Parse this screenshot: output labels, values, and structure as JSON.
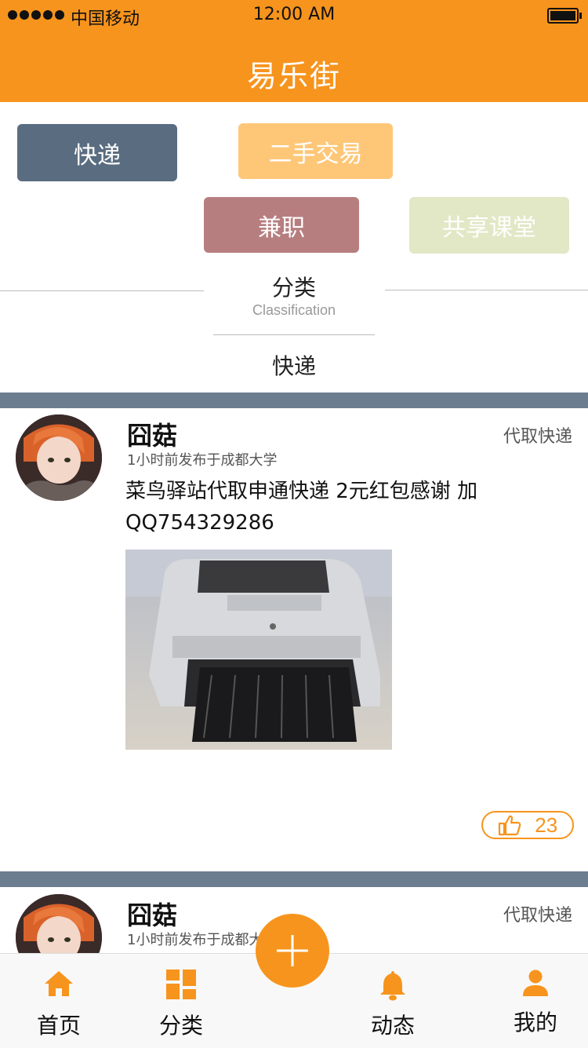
{
  "status_bar": {
    "carrier": "中国移动",
    "time": "12:00 AM"
  },
  "header": {
    "title": "易乐街"
  },
  "categories": {
    "tags": [
      {
        "label": "快递",
        "color": "#5a6d80"
      },
      {
        "label": "二手交易",
        "color": "#fec778"
      },
      {
        "label": "兼职",
        "color": "#b77e80"
      },
      {
        "label": "共享课堂",
        "color": "#e2e7c5"
      }
    ],
    "section_title": "分类",
    "section_subtitle": "Classification",
    "current": "快递"
  },
  "posts": [
    {
      "author": "囧菇",
      "time": "1小时前发布于成都大学",
      "tag": "代取快递",
      "content": "菜鸟驿站代取申通快递 2元红包感谢 加QQ754329286",
      "likes": "23",
      "image_icon": "printer-photo"
    },
    {
      "author": "囧菇",
      "time": "1小时前发布于成都大学",
      "tag": "代取快递"
    }
  ],
  "tabbar": {
    "items": [
      {
        "label": "首页",
        "icon": "home-icon"
      },
      {
        "label": "分类",
        "icon": "grid-icon"
      },
      {
        "label": "动态",
        "icon": "bell-icon"
      },
      {
        "label": "我的",
        "icon": "user-icon"
      }
    ],
    "fab_icon": "plus-icon"
  },
  "colors": {
    "accent": "#f7941d",
    "band": "#6b7d8e"
  }
}
